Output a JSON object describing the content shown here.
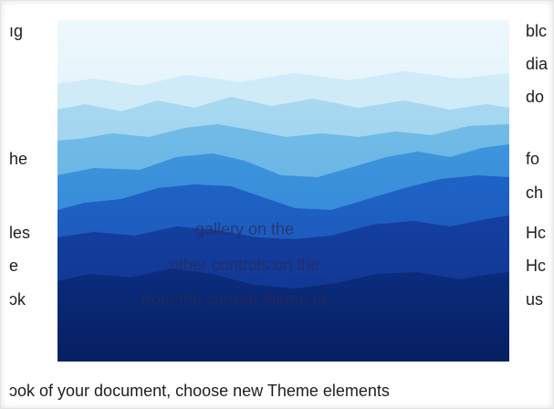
{
  "left_column": [
    "ıg",
    "he",
    "les",
    "e",
    "ɔk"
  ],
  "right_column": [
    "blc",
    "dia",
    "do",
    "fo",
    "ch",
    "Hc",
    "Hc",
    "us"
  ],
  "overlay": {
    "line1": "gallery on the",
    "line2": "other controls on the",
    "line3": "from the current theme or"
  },
  "bottom_text": "ɔok of your document, choose new Theme elements",
  "image": {
    "icon": "mountain-landscape-image",
    "colors": {
      "sky": "#d6eef9",
      "ridge1": "#9fd3ee",
      "ridge2": "#6cb7e6",
      "ridge3": "#3f8fd8",
      "ridge4": "#2266c7",
      "ridge5": "#123f9c",
      "ridge6": "#0b2b78"
    }
  }
}
